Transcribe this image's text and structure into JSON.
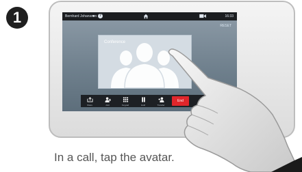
{
  "step": {
    "number": "1"
  },
  "status_bar": {
    "user": "Bernhard Johansson",
    "time": "16:33"
  },
  "reset_label": "RESET",
  "conference": {
    "title": "Conference"
  },
  "pager": {
    "count": 2,
    "active": 0
  },
  "call_controls": {
    "buttons": [
      {
        "label": "Share",
        "icon": "share-icon"
      },
      {
        "label": "Add",
        "icon": "add-participant-icon"
      },
      {
        "label": "Keypad",
        "icon": "keypad-icon"
      },
      {
        "label": "Hold",
        "icon": "pause-icon"
      },
      {
        "label": "Transfer",
        "icon": "transfer-icon"
      }
    ],
    "end_label": "End"
  },
  "caption": "In a call, tap the avatar.",
  "colors": {
    "end_button": "#e0262b",
    "screen": "#7b8b97",
    "status_bar": "#1b1d20"
  }
}
